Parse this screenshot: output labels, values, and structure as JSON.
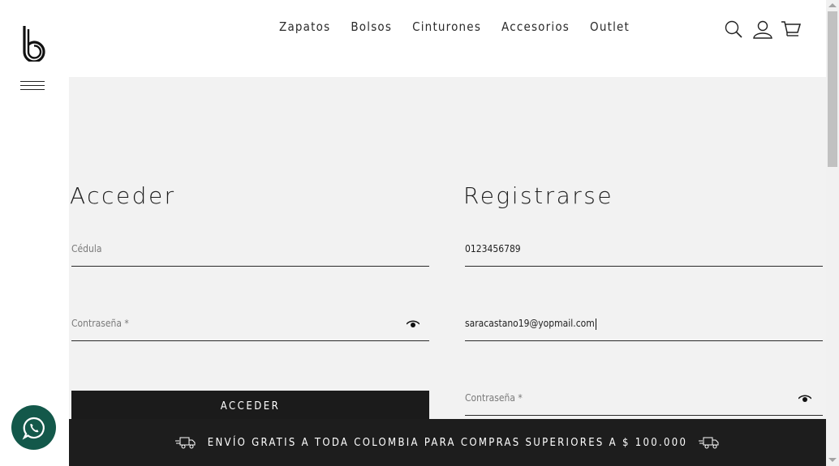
{
  "header": {
    "nav": [
      "Zapatos",
      "Bolsos",
      "Cinturones",
      "Accesorios",
      "Outlet"
    ],
    "icons": [
      "search-icon",
      "user-icon",
      "cart-icon"
    ],
    "logo_icon": "brand-b-logo",
    "menu_icon": "hamburger-icon"
  },
  "login": {
    "title": "Acceder",
    "cedula_placeholder": "Cédula",
    "password_placeholder": "Contraseña *",
    "button_label": "ACCEDER"
  },
  "register": {
    "title": "Registrarse",
    "cedula_value": "0123456789",
    "email_value": "saracastano19@yopmail.com",
    "password_placeholder": "Contraseña *"
  },
  "promo": {
    "text": "ENVÍO GRATIS A TODA COLOMBIA PARA COMPRAS SUPERIORES A $ 100.000",
    "icon": "delivery-truck-icon"
  },
  "whatsapp": {
    "icon": "whatsapp-icon",
    "color": "#13584a"
  },
  "colors": {
    "panel_bg": "#f2f2f2",
    "dark": "#1d1d1d"
  }
}
